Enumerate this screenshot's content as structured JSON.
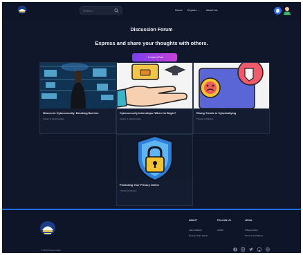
{
  "nav": {
    "search_placeholder": "Search...",
    "home": "Home",
    "explore": "Explore",
    "about": "About Us"
  },
  "hero": {
    "title": "Discussion Forum",
    "subtitle": "Express and share your thoughts with others.",
    "create_button": "+ Create a Post"
  },
  "cards": [
    {
      "title": "Women in Cybersecurity: Breaking Barriers",
      "category": "Career & Opportunities"
    },
    {
      "title": "Cybersecurity Internships: Where to Begin?",
      "category": "Career & Opportunities"
    },
    {
      "title": "Rising Trends in Cyberbullying",
      "category": "Threats & Solution"
    },
    {
      "title": "Protecting Your Privacy Online",
      "category": "Threats & Solution"
    }
  ],
  "footer": {
    "about": {
      "heading": "ABOUT",
      "links": [
        "Ulam Hijabina",
        "Rescue Ulam Portal"
      ]
    },
    "follow": {
      "heading": "FOLLOW US",
      "links": [
        "Github"
      ]
    },
    "legal": {
      "heading": "LEGAL",
      "links": [
        "Privacy Policy",
        "Terms & Conditions"
      ]
    },
    "copyright": "© 2024 Rescue Ulam"
  },
  "colors": {
    "accent": "#1d6ff0",
    "background": "#10172b",
    "button_gradient": [
      "#7a3ff0",
      "#c940d8"
    ]
  }
}
